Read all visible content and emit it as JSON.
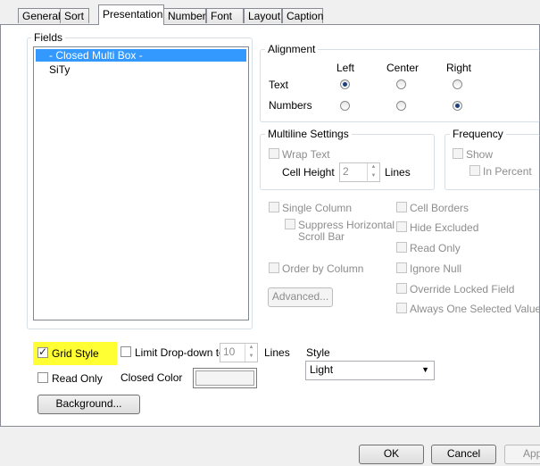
{
  "tabs": [
    {
      "label": "General"
    },
    {
      "label": "Sort"
    },
    {
      "label": "Presentation"
    },
    {
      "label": "Number"
    },
    {
      "label": "Font"
    },
    {
      "label": "Layout"
    },
    {
      "label": "Caption"
    }
  ],
  "fields": {
    "title": "Fields",
    "items": [
      "- Closed Multi Box -",
      "SiTy"
    ]
  },
  "alignment": {
    "title": "Alignment",
    "col_left": "Left",
    "col_center": "Center",
    "col_right": "Right",
    "row_text": "Text",
    "row_numbers": "Numbers",
    "text_selected": "Left",
    "numbers_selected": "Right"
  },
  "multiline": {
    "title": "Multiline Settings",
    "wrap_text": "Wrap Text",
    "cell_height_label": "Cell Height",
    "cell_height_value": "2",
    "lines_label": "Lines"
  },
  "frequency": {
    "title": "Frequency",
    "show": "Show",
    "in_percent": "In Percent"
  },
  "options": {
    "single_column": "Single Column",
    "suppress_hscroll_line1": "Suppress Horizontal",
    "suppress_hscroll_line2": "Scroll Bar",
    "order_by_column": "Order by Column",
    "advanced_button": "Advanced...",
    "cell_borders": "Cell Borders",
    "hide_excluded": "Hide Excluded",
    "read_only": "Read Only",
    "ignore_null": "Ignore Null",
    "override_locked": "Override Locked Field",
    "always_one_selected": "Always One Selected Value"
  },
  "bottom": {
    "grid_style": "Grid Style",
    "grid_style_checked": true,
    "limit_dropdown": "Limit Drop-down to",
    "limit_value": "10",
    "lines_label": "Lines",
    "style_label": "Style",
    "style_value": "Light",
    "read_only": "Read Only",
    "closed_color": "Closed Color",
    "background_button": "Background..."
  },
  "dialog": {
    "ok": "OK",
    "cancel": "Cancel",
    "apply": "Apply"
  },
  "colors": {
    "highlight": "#ffff33",
    "selection": "#3399ff"
  }
}
